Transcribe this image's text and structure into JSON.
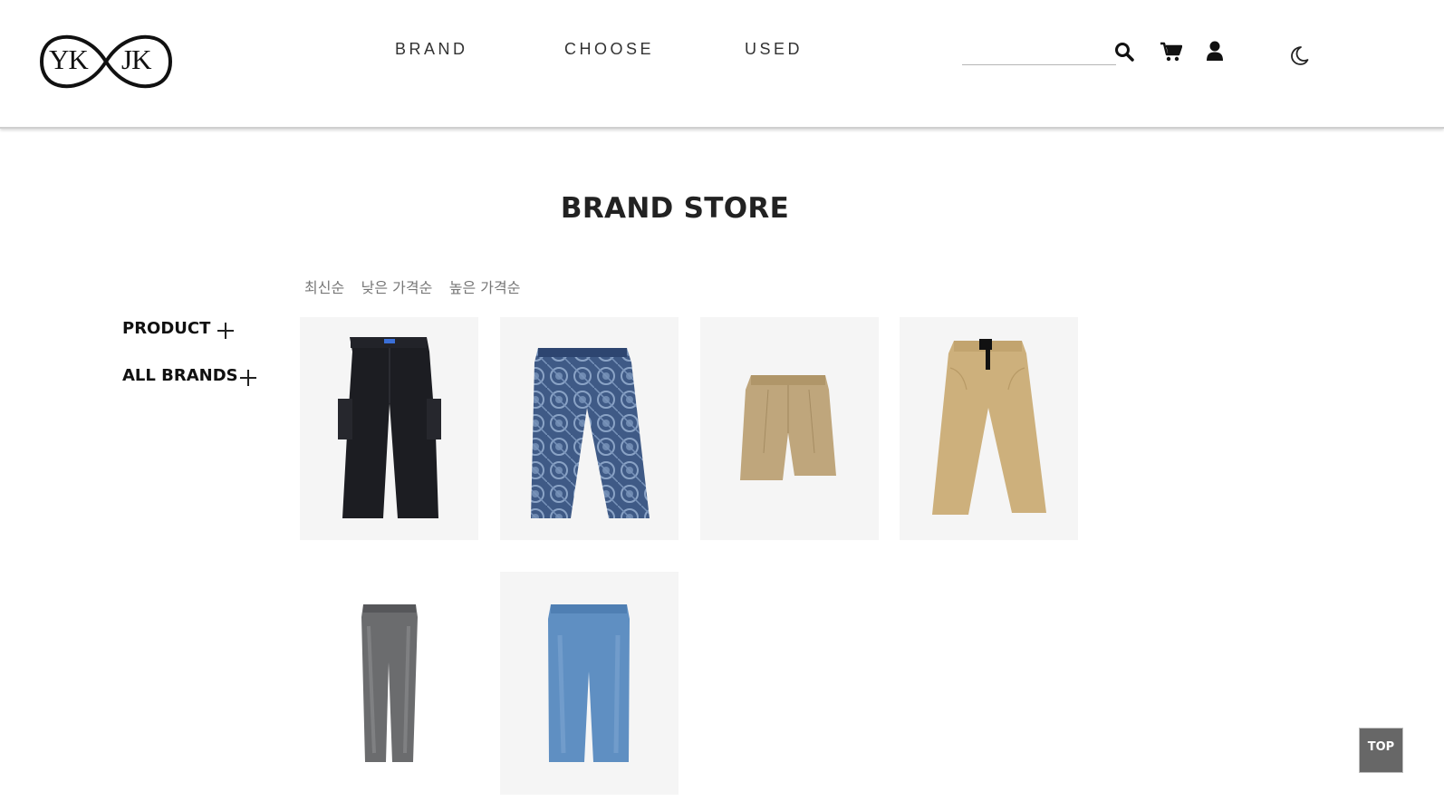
{
  "logo": {
    "left_text": "YK",
    "right_text": "JK"
  },
  "nav": {
    "items": [
      {
        "label": "BRAND"
      },
      {
        "label": "CHOOSE"
      },
      {
        "label": "USED"
      }
    ]
  },
  "search": {
    "value": "",
    "placeholder": ""
  },
  "icons": [
    "search-icon",
    "cart-icon",
    "user-icon",
    "moon-icon"
  ],
  "page": {
    "title": "BRAND STORE"
  },
  "sort": {
    "options": [
      "최신순",
      "낮은 가격순",
      "높은 가격순"
    ]
  },
  "sidebar": {
    "items": [
      {
        "label": "PRODUCT"
      },
      {
        "label": "ALL BRANDS"
      }
    ]
  },
  "products": [
    {
      "image": "black-cargo-pants"
    },
    {
      "image": "patterned-denim-jeans"
    },
    {
      "image": "beige-shorts"
    },
    {
      "image": "khaki-belted-pants"
    },
    {
      "image": "grey-washed-jeans"
    },
    {
      "image": "light-blue-jeans"
    }
  ],
  "top_button": {
    "label": "TOP"
  },
  "colors": {
    "card_bg": "#f5f5f5",
    "top_button_bg": "#676767",
    "text": "#222222"
  }
}
